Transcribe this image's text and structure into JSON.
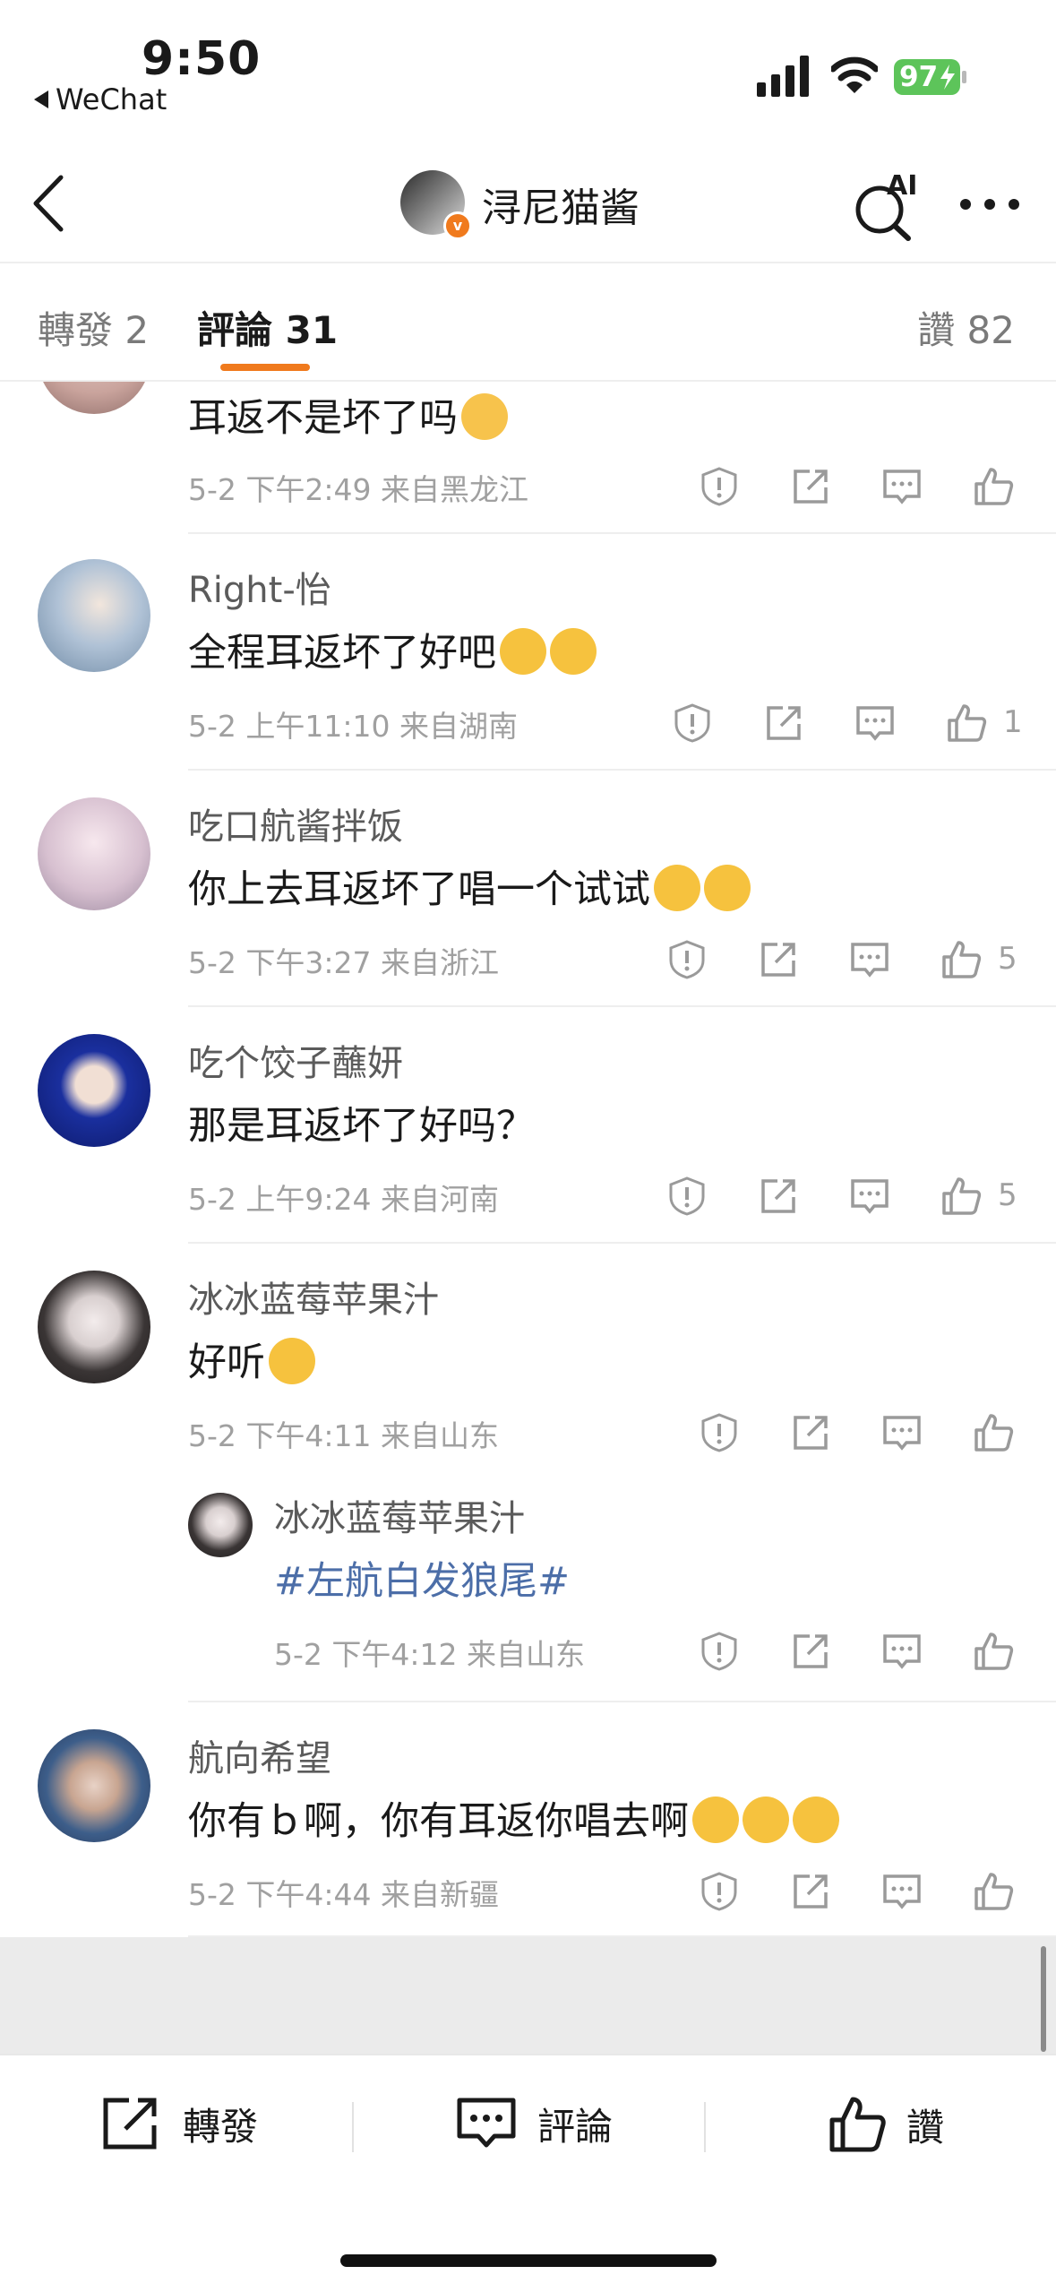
{
  "status_bar": {
    "time": "9:50",
    "back_app": "WeChat",
    "battery": "97"
  },
  "nav": {
    "title": "浔尼猫酱",
    "ai_label": "AI"
  },
  "tabs": {
    "forward": "轉發 2",
    "comment": "評論 31",
    "like": "讚 82"
  },
  "comments": [
    {
      "user": "",
      "text": "耳返不是坏了吗",
      "meta": "5-2 下午2:49 来自黑龙江",
      "likes": ""
    },
    {
      "user": "Right-怡",
      "text": "全程耳返坏了好吧",
      "meta": "5-2 上午11:10 来自湖南",
      "likes": "1"
    },
    {
      "user": "吃口航酱拌饭",
      "text": "你上去耳返坏了唱一个试试",
      "meta": "5-2 下午3:27 来自浙江",
      "likes": "5"
    },
    {
      "user": "吃个饺子蘸妍",
      "text": "那是耳返坏了好吗？",
      "meta": "5-2 上午9:24 来自河南",
      "likes": "5"
    },
    {
      "user": "冰冰蓝莓苹果汁",
      "text": "好听",
      "meta": "5-2 下午4:11 来自山东",
      "likes": ""
    },
    {
      "user": "冰冰蓝莓苹果汁",
      "text": "#左航白发狼尾#",
      "meta": "5-2 下午4:12 来自山东",
      "likes": ""
    },
    {
      "user": "航向希望",
      "text": "你有ｂ啊，你有耳返你唱去啊",
      "meta": "5-2 下午4:44 来自新疆",
      "likes": ""
    }
  ],
  "bottom_bar": {
    "forward": "轉發",
    "comment": "評論",
    "like": "讚"
  },
  "colors": {
    "accent": "#f07a1d",
    "hashtag": "#4c6ea8",
    "meta": "#a0a0a0"
  }
}
